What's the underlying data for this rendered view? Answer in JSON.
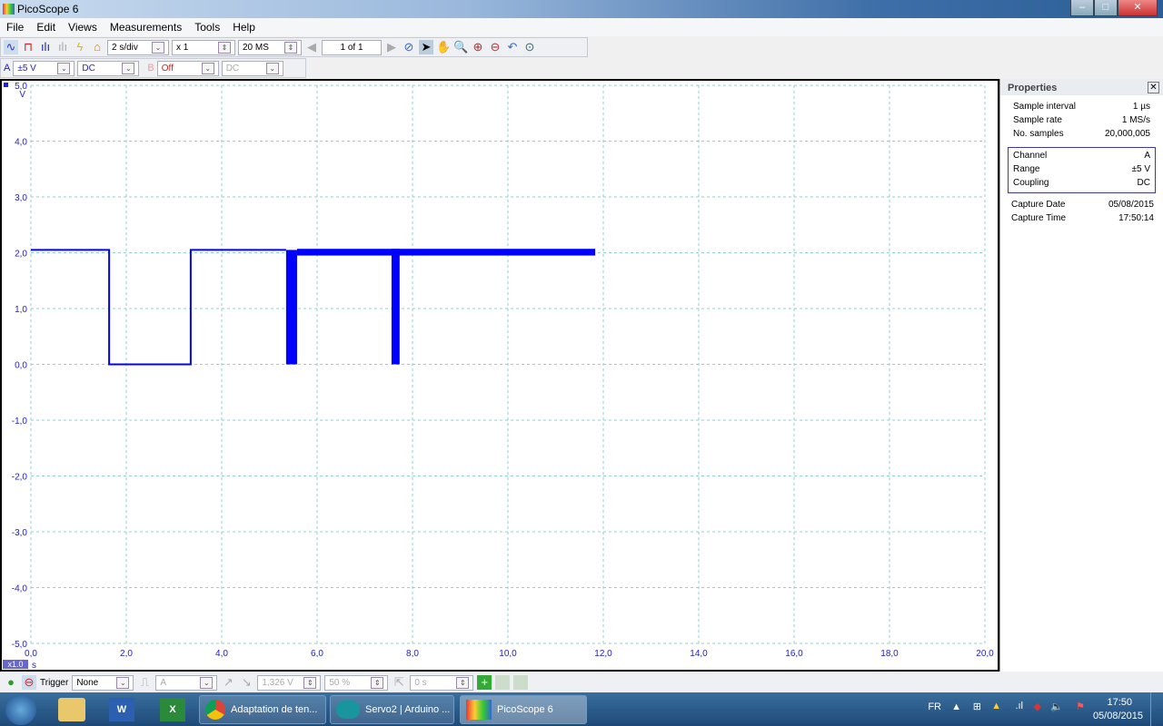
{
  "window": {
    "title": "PicoScope 6",
    "minimize": "–",
    "maximize": "□",
    "close": "✕"
  },
  "menu": [
    "File",
    "Edit",
    "Views",
    "Measurements",
    "Tools",
    "Help"
  ],
  "toolbar": {
    "timebase": "2 s/div",
    "zoom": "x 1",
    "samples": "20 MS",
    "page": "1 of 1"
  },
  "channel_bar": {
    "a_label": "A",
    "a_range": "±5 V",
    "a_coupling": "DC",
    "b_label": "B",
    "b_range": "Off",
    "b_coupling": "DC"
  },
  "plot": {
    "y_unit": "V",
    "x_unit": "s",
    "x_zoom": "x1.0",
    "y_ticks": [
      "5,0",
      "4,0",
      "3,0",
      "2,0",
      "1,0",
      "0,0",
      "-1,0",
      "-2,0",
      "-3,0",
      "-4,0",
      "-5,0"
    ],
    "x_ticks": [
      "0,0",
      "2,0",
      "4,0",
      "6,0",
      "8,0",
      "10,0",
      "12,0",
      "14,0",
      "16,0",
      "18,0",
      "20,0"
    ],
    "trace_color": "#0000ff"
  },
  "chart_data": {
    "type": "line",
    "xlabel": "s",
    "ylabel": "V",
    "xlim": [
      0,
      20
    ],
    "ylim": [
      -5,
      5
    ],
    "segments": [
      {
        "x": [
          0,
          1.64,
          1.64,
          3.35,
          3.35,
          5.35
        ],
        "y": [
          2.05,
          2.05,
          0,
          0,
          2.05,
          2.05
        ],
        "noisy": false
      },
      {
        "x": [
          5.35,
          5.58
        ],
        "ymin": 0,
        "ymax": 2.05,
        "noisy": true
      },
      {
        "x": [
          5.58,
          11.83
        ],
        "ymin": 1.95,
        "ymax": 2.07,
        "noisy": true
      },
      {
        "x": [
          7.56,
          7.73
        ],
        "ymin": 0,
        "ymax": 2.07,
        "noisy": true
      }
    ]
  },
  "properties": {
    "title": "Properties",
    "general": [
      [
        "Sample interval",
        "1 µs"
      ],
      [
        "Sample rate",
        "1 MS/s"
      ],
      [
        "No. samples",
        "20,000,005"
      ]
    ],
    "channel": [
      [
        "Channel",
        "A"
      ],
      [
        "Range",
        "±5 V"
      ],
      [
        "Coupling",
        "DC"
      ]
    ],
    "capture": [
      [
        "Capture Date",
        "05/08/2015"
      ],
      [
        "Capture Time",
        "17:50:14"
      ]
    ]
  },
  "trigger": {
    "label": "Trigger",
    "mode": "None",
    "source": "A",
    "level": "1,326 V",
    "pretrigger": "50 %",
    "delay": "0 s"
  },
  "taskbar": {
    "buttons": [
      "Adaptation de ten...",
      "Servo2 | Arduino ...",
      "PicoScope 6"
    ],
    "lang": "FR",
    "time": "17:50",
    "date": "05/08/2015"
  }
}
